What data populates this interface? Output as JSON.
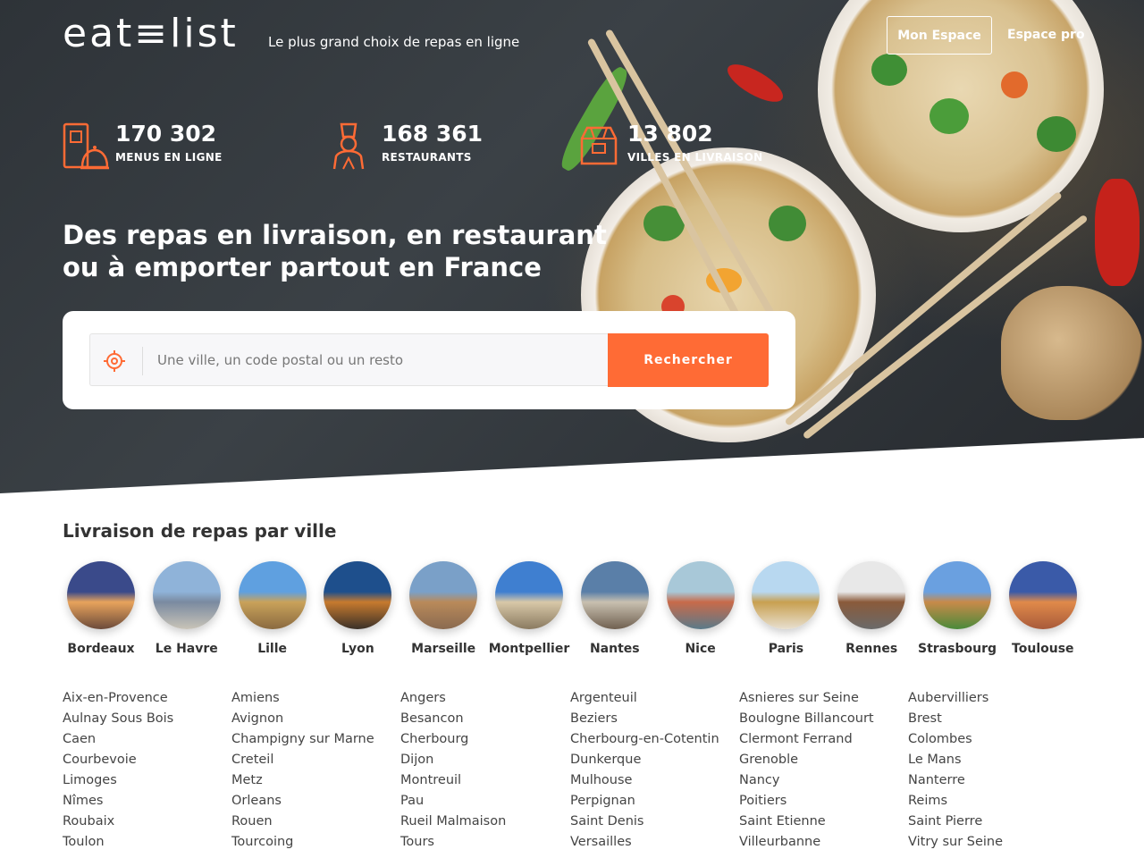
{
  "header": {
    "logo_text": "eat≡list",
    "tagline": "Le plus grand choix de repas en ligne",
    "mon_espace": "Mon Espace",
    "espace_pro": "Espace pro"
  },
  "stats": [
    {
      "value": "170 302",
      "label": "MENUS EN LIGNE",
      "icon": "menu-cloche-icon"
    },
    {
      "value": "168 361",
      "label": "RESTAURANTS",
      "icon": "chef-icon"
    },
    {
      "value": "13 802",
      "label": "VILLES EN LIVRAISON",
      "icon": "delivery-bag-icon"
    }
  ],
  "headline": "Des repas en livraison, en restaurant ou à emporter partout en France",
  "search": {
    "placeholder": "Une ville, un code postal ou un resto",
    "button": "Rechercher"
  },
  "cities_section": {
    "title": "Livraison de repas par ville",
    "featured": [
      "Bordeaux",
      "Le Havre",
      "Lille",
      "Lyon",
      "Marseille",
      "Montpellier",
      "Nantes",
      "Nice",
      "Paris",
      "Rennes",
      "Strasbourg",
      "Toulouse"
    ],
    "columns": [
      [
        "Aix-en-Provence",
        "Aulnay Sous Bois",
        "Caen",
        "Courbevoie",
        "Limoges",
        "Nîmes",
        "Roubaix",
        "Toulon"
      ],
      [
        "Amiens",
        "Avignon",
        "Champigny sur Marne",
        "Creteil",
        "Metz",
        "Orleans",
        "Rouen",
        "Tourcoing"
      ],
      [
        "Angers",
        "Besancon",
        "Cherbourg",
        "Dijon",
        "Montreuil",
        "Pau",
        "Rueil Malmaison",
        "Tours"
      ],
      [
        "Argenteuil",
        "Beziers",
        "Cherbourg-en-Cotentin",
        "Dunkerque",
        "Mulhouse",
        "Perpignan",
        "Saint Denis",
        "Versailles"
      ],
      [
        "Asnieres sur Seine",
        "Boulogne Billancourt",
        "Clermont Ferrand",
        "Grenoble",
        "Nancy",
        "Poitiers",
        "Saint Etienne",
        "Villeurbanne"
      ],
      [
        "Aubervilliers",
        "Brest",
        "Colombes",
        "Le Mans",
        "Nanterre",
        "Reims",
        "Saint Pierre",
        "Vitry sur Seine"
      ]
    ]
  },
  "colors": {
    "accent": "#ff6b35",
    "text": "#333333"
  }
}
